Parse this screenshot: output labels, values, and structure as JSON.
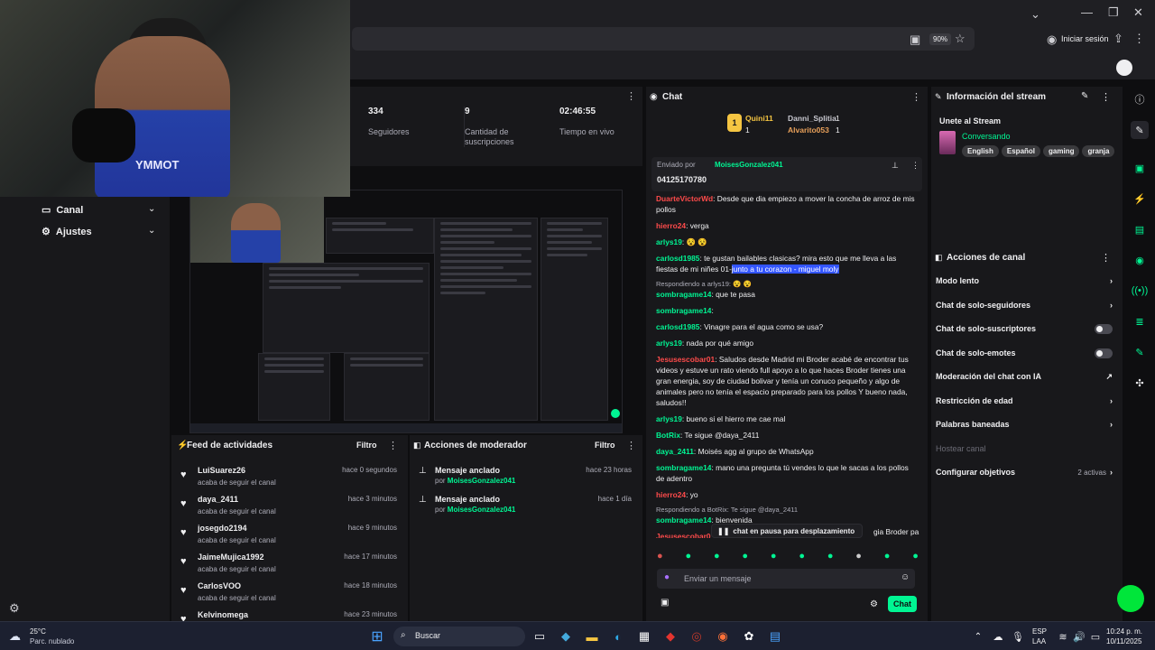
{
  "browser": {
    "zoom": "90%",
    "signin_label": "Iniciar sesión"
  },
  "webcam": {
    "shirt_text": "YMMOT"
  },
  "nav": {
    "items": [
      {
        "label": "Canal",
        "icon": "tv-icon"
      },
      {
        "label": "Ajustes",
        "icon": "gear-icon"
      }
    ]
  },
  "stats": [
    {
      "value": "334",
      "label": "Seguidores"
    },
    {
      "value": "9",
      "label": "Cantidad de suscripciones"
    },
    {
      "value": "02:46:55",
      "label": "Tiempo en vivo"
    }
  ],
  "feed": {
    "title": "Feed de actividades",
    "filter_label": "Filtro",
    "items": [
      {
        "user": "LuiSuarez26",
        "action": "acaba de seguir el canal",
        "time": "hace 0 segundos"
      },
      {
        "user": "daya_2411",
        "action": "acaba de seguir el canal",
        "time": "hace 3 minutos"
      },
      {
        "user": "josegdo2194",
        "action": "acaba de seguir el canal",
        "time": "hace 9 minutos"
      },
      {
        "user": "JaimeMujica1992",
        "action": "acaba de seguir el canal",
        "time": "hace 17 minutos"
      },
      {
        "user": "CarlosVOO",
        "action": "acaba de seguir el canal",
        "time": "hace 18 minutos"
      },
      {
        "user": "Kelvinomega",
        "action": "",
        "time": "hace 23 minutos"
      }
    ]
  },
  "mod": {
    "title": "Acciones de moderador",
    "filter_label": "Filtro",
    "items": [
      {
        "title": "Mensaje anclado",
        "by_prefix": "por",
        "by": "MoisesGonzalez041",
        "time": "hace 23 horas"
      },
      {
        "title": "Mensaje anclado",
        "by_prefix": "por",
        "by": "MoisesGonzalez041",
        "time": "hace 1 día"
      }
    ]
  },
  "chat": {
    "title": "Chat",
    "leaders": [
      {
        "rank": "1",
        "name": "Quini11",
        "count": "1"
      },
      {
        "rank": "",
        "name": "Danni_Splitia",
        "count": "1"
      },
      {
        "rank": "",
        "name": "Alvarito053",
        "count": "1"
      }
    ],
    "pinned": {
      "sent_by_prefix": "Enviado por",
      "sent_by": "MoisesGonzalez041",
      "text": "04125170780"
    },
    "messages": [
      {
        "user": "DuarteVictorWd",
        "color": "#ff4b4b",
        "text": ": Desde que dia empiezo a mover la concha de arroz de mis pollos"
      },
      {
        "user": "hierro24",
        "color": "#ff4b4b",
        "text": ": verga"
      },
      {
        "user": "arlys19",
        "color": "#00f593",
        "text": ": 😵 😵"
      },
      {
        "user": "carlosd1985",
        "color": "#00f593",
        "text": ": te gustan bailables clasicas? mira esto que me lleva a las fiestas de mi niñes 01-",
        "highlight": "junto a tu corazon - miguel moly"
      },
      {
        "reply": "Respondiendo a arlys19: 😵 😵",
        "user": "sombragame14",
        "color": "#00f593",
        "text": ": que te pasa"
      },
      {
        "user": "sombragame14",
        "color": "#00f593",
        "text": ":"
      },
      {
        "user": "carlosd1985",
        "color": "#00f593",
        "text": ": Vinagre para el agua como se usa?"
      },
      {
        "user": "arlys19",
        "color": "#00f593",
        "text": ": nada por qué amigo"
      },
      {
        "user": "Jesusescobar01",
        "color": "#ff4b4b",
        "text": ": Saludos desde Madrid mi Broder acabé de encontrar tus videos y estuve un rato viendo full apoyo a lo que haces Broder tienes una gran energia, soy de ciudad bolivar y tenía un conuco pequeño y algo de animales pero no tenía el espacio preparado para los pollos Y bueno nada, saludos!!"
      },
      {
        "user": "arlys19",
        "color": "#00f593",
        "text": ": bueno si el hierro me cae mal"
      },
      {
        "user": "BotRix",
        "color": "#00f593",
        "text": ": Te sigue @daya_2411"
      },
      {
        "user": "daya_2411",
        "color": "#00f593",
        "text": ": Moisés agg al grupo de WhatsApp"
      },
      {
        "user": "sombragame14",
        "color": "#00f593",
        "text": ": mano una pregunta tú vendes lo que le sacas a los pollos de adentro"
      },
      {
        "user": "hierro24",
        "color": "#ff4b4b",
        "text": ": yo"
      },
      {
        "reply": "Respondiendo a BotRix: Te sigue @daya_2411",
        "user": "sombragame14",
        "color": "#00f593",
        "text": ": bienvenida"
      },
      {
        "user": "Jesusescobar0",
        "color": "#ff4b4b",
        "text": ""
      }
    ],
    "paused_label": "chat en pausa para desplazamiento",
    "paused_tail": "gia Broder pa",
    "input_placeholder": "Enviar un mensaje",
    "send_label": "Chat"
  },
  "info": {
    "title": "Información del stream",
    "stream_title": "Unete al Stream",
    "category": "Conversando",
    "tags": [
      "English",
      "Español",
      "gaming",
      "granja"
    ]
  },
  "actions": {
    "title": "Acciones de canal",
    "items": [
      {
        "label": "Modo lento",
        "control": "arrow"
      },
      {
        "label": "Chat de solo-seguidores",
        "control": "arrow"
      },
      {
        "label": "Chat de solo-suscriptores",
        "control": "toggle"
      },
      {
        "label": "Chat de solo-emotes",
        "control": "toggle"
      },
      {
        "label": "Moderación del chat con IA",
        "control": "external"
      },
      {
        "label": "Restricción de edad",
        "control": "arrow"
      },
      {
        "label": "Palabras baneadas",
        "control": "arrow"
      },
      {
        "label": "Hostear canal",
        "control": "none",
        "disabled": true
      },
      {
        "label": "Configurar objetivos",
        "control": "arrow",
        "badge": "2 activas"
      }
    ]
  },
  "taskbar": {
    "weather_temp": "25°C",
    "weather_desc": "Parc. nublado",
    "search_label": "Buscar",
    "lang1": "ESP",
    "lang2": "LAA",
    "time": "10:24 p. m.",
    "date": "10/11/2025"
  }
}
